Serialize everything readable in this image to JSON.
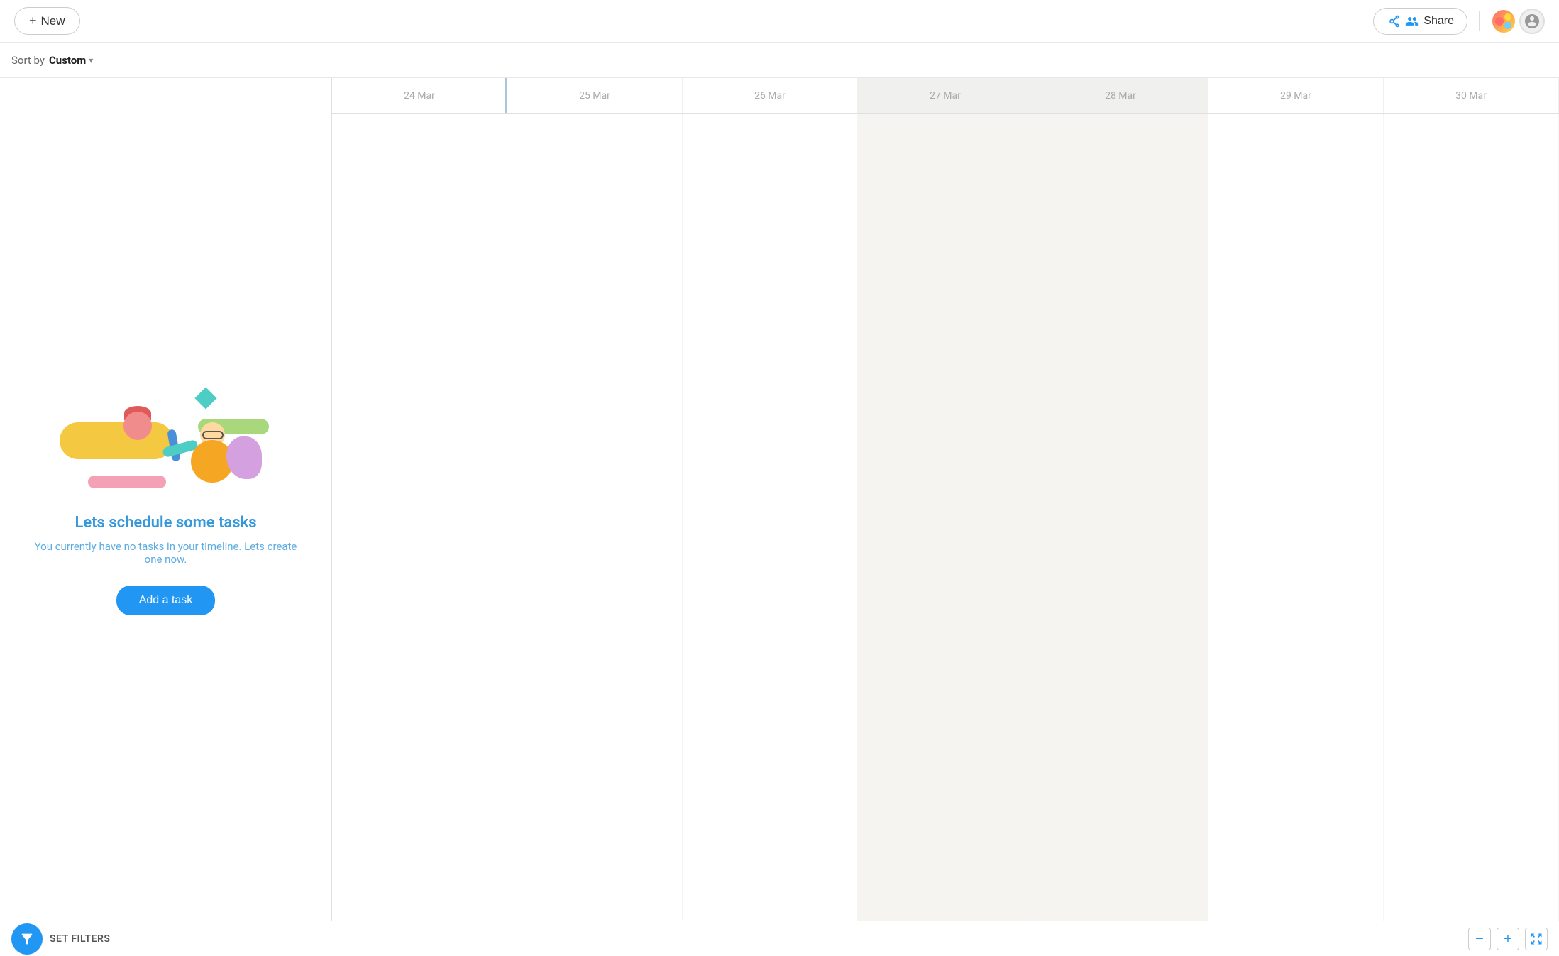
{
  "toolbar": {
    "new_label": "New",
    "new_plus": "+",
    "share_label": "Share"
  },
  "sort_bar": {
    "prefix": "Sort by",
    "value": "Custom"
  },
  "timeline": {
    "dates": [
      "24 Mar",
      "25 Mar",
      "26 Mar",
      "27 Mar",
      "28 Mar",
      "29 Mar",
      "30 Mar"
    ],
    "today_range_start": 3,
    "today_range_end": 4
  },
  "empty_state": {
    "title": "Lets schedule some tasks",
    "subtitle": "You currently have no tasks in your timeline. Lets create one now.",
    "cta": "Add a task"
  },
  "bottom_bar": {
    "set_filters": "SET FILTERS"
  }
}
